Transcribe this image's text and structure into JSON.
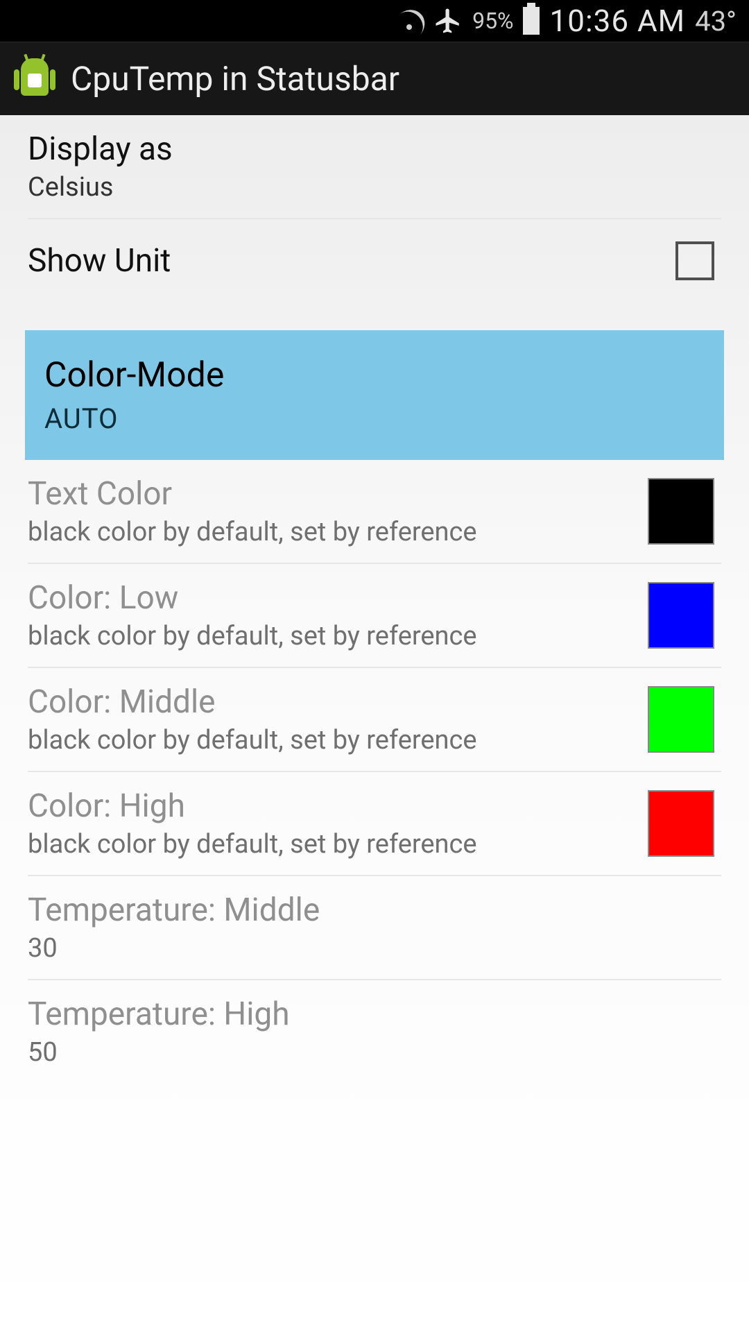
{
  "statusbar": {
    "battery_pct": "95%",
    "time": "10:36 AM",
    "temp": "43°",
    "icons": {
      "wifi": "wifi-icon",
      "airplane": "airplane-icon",
      "battery": "battery-icon"
    }
  },
  "actionbar": {
    "title": "CpuTemp in Statusbar"
  },
  "prefs": {
    "display_as": {
      "title": "Display as",
      "value": "Celsius"
    },
    "show_unit": {
      "title": "Show Unit",
      "checked": false
    },
    "color_mode": {
      "title": "Color-Mode",
      "value": "AUTO"
    },
    "text_color": {
      "title": "Text Color",
      "summary": "black color by default, set by reference",
      "color": "#000000"
    },
    "color_low": {
      "title": "Color: Low",
      "summary": "black color by default, set by reference",
      "color": "#0000ff"
    },
    "color_middle": {
      "title": "Color: Middle",
      "summary": "black color by default, set by reference",
      "color": "#00ff00"
    },
    "color_high": {
      "title": "Color: High",
      "summary": "black color by default, set by reference",
      "color": "#ff0000"
    },
    "temp_middle": {
      "title": "Temperature: Middle",
      "value": "30"
    },
    "temp_high": {
      "title": "Temperature: High",
      "value": "50"
    }
  }
}
